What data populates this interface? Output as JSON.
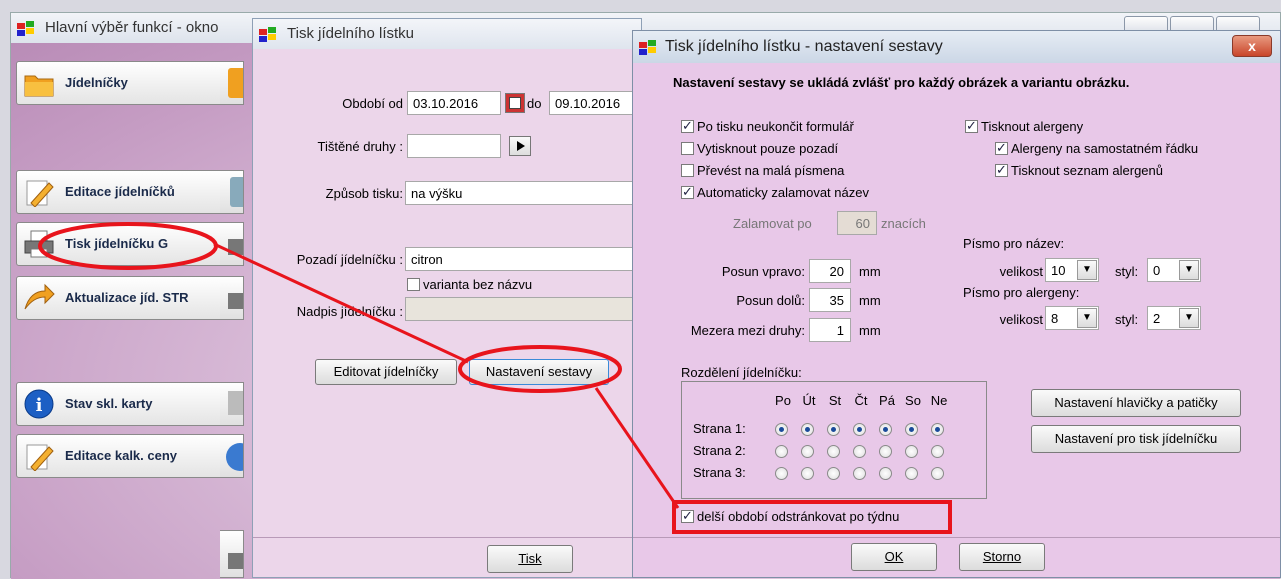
{
  "main_window": {
    "title": "Hlavní výběr funkcí - okno",
    "buttons": [
      {
        "label": "Jídelníčky",
        "icon": "folder-icon"
      },
      {
        "label": "Editace jídelníčků",
        "icon": "pencil-icon"
      },
      {
        "label": "Tisk jídelníčku G",
        "icon": "printer-icon"
      },
      {
        "label": "Aktualizace jíd. STR",
        "icon": "arrow-icon"
      },
      {
        "label": "Stav skl. karty",
        "icon": "info-icon"
      },
      {
        "label": "Editace kalk. ceny",
        "icon": "pencil-icon"
      }
    ]
  },
  "print_dialog": {
    "title": "Tisk jídelního lístku",
    "period_from_label": "Období od",
    "period_from": "03.10.2016",
    "period_to_label": "do",
    "period_to": "09.10.2016",
    "printed_types_label": "Tištěné druhy :",
    "printed_types": "",
    "print_mode_label": "Způsob tisku:",
    "print_mode": "na výšku",
    "background_label": "Pozadí jídelníčku :",
    "background": "citron",
    "variant_no_name": "varianta bez názvu",
    "heading_label": "Nadpis jídelníčku :",
    "heading": "",
    "edit_menus_button": "Editovat jídelníčky",
    "report_settings_button": "Nastavení sestavy",
    "print_button": "Tisk"
  },
  "settings_dialog": {
    "title": "Tisk jídelního lístku - nastavení sestavy",
    "close": "x",
    "info": "Nastavení sestavy se ukládá zvlášť pro každý obrázek a variantu obrázku.",
    "checkboxes_left": [
      {
        "label": "Po tisku neukončit formulář",
        "checked": true
      },
      {
        "label": "Vytisknout pouze pozadí",
        "checked": false
      },
      {
        "label": "Převést na malá písmena",
        "checked": false
      },
      {
        "label": "Automaticky zalamovat název",
        "checked": true
      }
    ],
    "wrap_label": "Zalamovat po",
    "wrap_value": "60",
    "wrap_unit": "znacích",
    "print_allergens": {
      "label": "Tisknout alergeny",
      "checked": true
    },
    "allergens_separate_line": {
      "label": "Alergeny na samostatném řádku",
      "checked": true
    },
    "print_allergen_list": {
      "label": "Tisknout seznam alergenů",
      "checked": true
    },
    "shift_right_label": "Posun vpravo:",
    "shift_right": "20",
    "shift_down_label": "Posun dolů:",
    "shift_down": "35",
    "gap_label": "Mezera mezi druhy:",
    "gap": "1",
    "unit_mm": "mm",
    "font_name_label": "Písmo pro název:",
    "font_allergen_label": "Písmo pro alergeny:",
    "size_label": "velikost",
    "style_label": "styl:",
    "font_name_size": "10",
    "font_name_style": "0",
    "font_allergen_size": "8",
    "font_allergen_style": "2",
    "split_label": "Rozdělení jídelníčku:",
    "days": [
      "Po",
      "Út",
      "St",
      "Čt",
      "Pá",
      "So",
      "Ne"
    ],
    "pages": [
      {
        "label": "Strana 1:",
        "selected": true
      },
      {
        "label": "Strana 2:",
        "selected": false
      },
      {
        "label": "Strana 3:",
        "selected": false
      }
    ],
    "longer_period_checkbox": {
      "label": "delší období odstránkovat po týdnu",
      "checked": true
    },
    "header_footer_button": "Nastavení hlavičky a patičky",
    "menu_print_button": "Nastavení pro tisk jídelníčku",
    "ok_button": "OK",
    "cancel_button": "Storno"
  },
  "colors": {
    "annotation": "#e8141c",
    "dialog_bg": "#e8c8e8"
  }
}
